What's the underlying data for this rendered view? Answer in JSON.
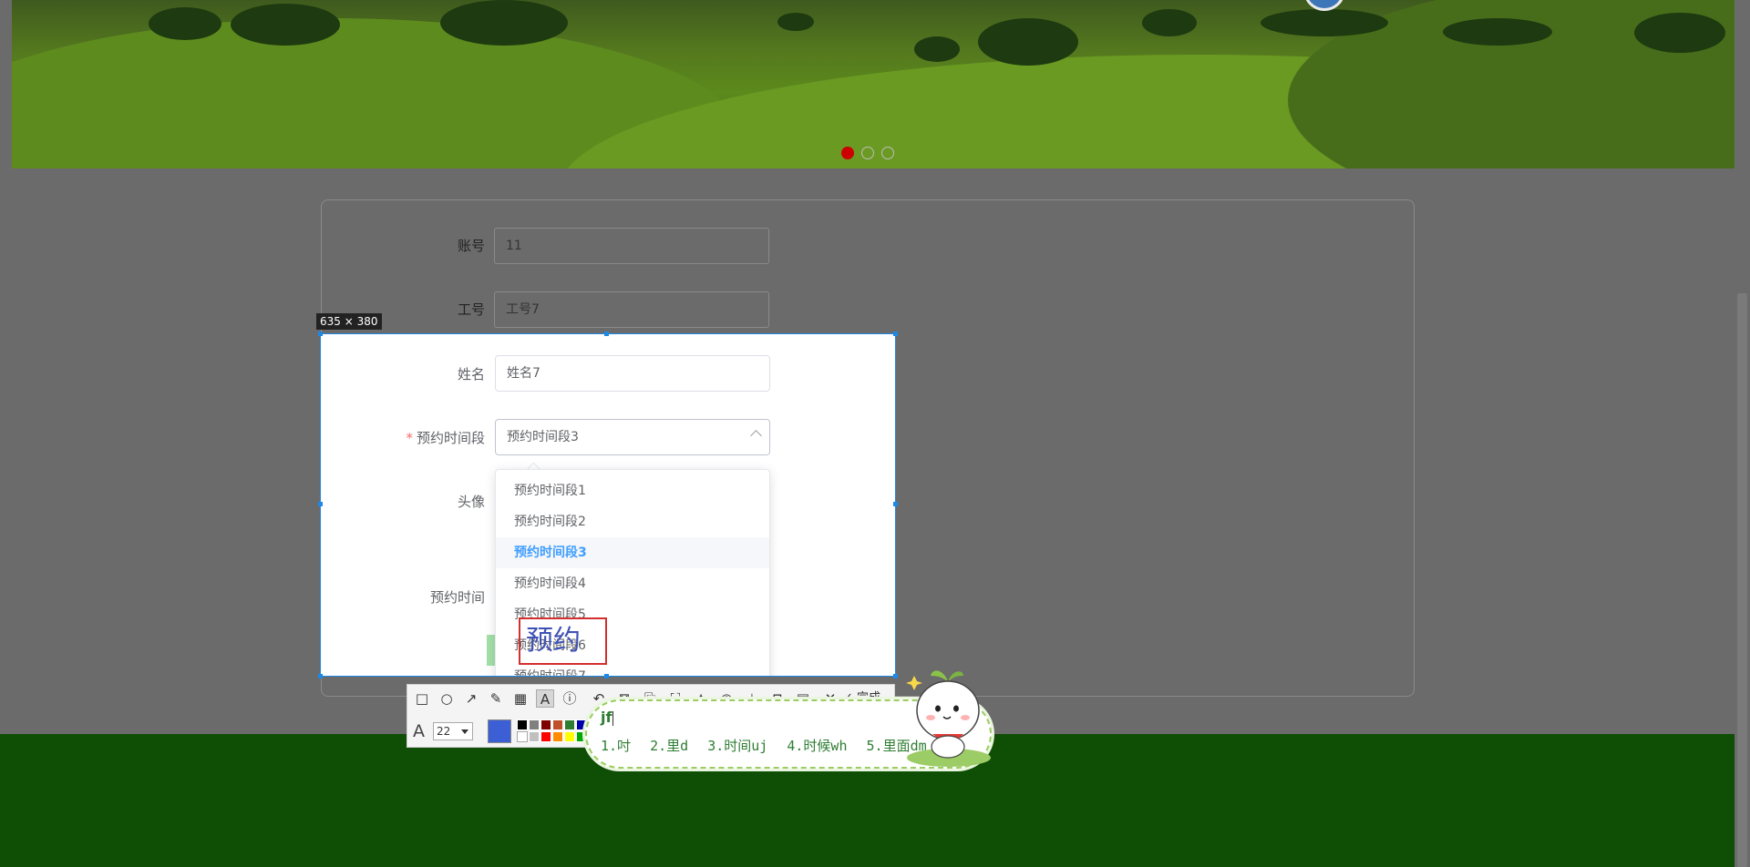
{
  "form": {
    "account_label": "账号",
    "account_value": "11",
    "employee_id_label": "工号",
    "employee_id_value": "工号7",
    "name_label": "姓名",
    "name_value": "姓名7",
    "time_slot_label": "预约时间段",
    "time_slot_required": "*",
    "time_slot_value": "预约时间段3",
    "avatar_label": "头像",
    "appointment_time_label": "预约时间"
  },
  "dropdown": {
    "options": [
      "预约时间段1",
      "预约时间段2",
      "预约时间段3",
      "预约时间段4",
      "预约时间段5",
      "预约时间段6",
      "预约时间段7"
    ],
    "selected_index": 2
  },
  "screenshot_tool": {
    "size_label": "635 × 380",
    "text_annotation": "预约",
    "done_label": "完成",
    "font_size": "22",
    "current_color": "#3d5fd6",
    "swatches_top": [
      "#000000",
      "#808080",
      "#800000",
      "#c0502a",
      "#2e7d32",
      "#0000aa"
    ],
    "swatches_bottom": [
      "#ffffff",
      "#c0c0c0",
      "#ff0000",
      "#ff8c00",
      "#ffff00",
      "#00aa00"
    ],
    "tools": [
      "rectangle-icon",
      "ellipse-icon",
      "arrow-icon",
      "pencil-icon",
      "mosaic-icon",
      "text-icon",
      "number-icon",
      "undo-icon",
      "crop-icon",
      "ocr-icon",
      "translate-icon",
      "pin-icon",
      "record-icon",
      "download-icon",
      "bookmark-icon",
      "copy-icon",
      "close-icon"
    ]
  },
  "ime": {
    "composition": "jf",
    "candidates": [
      "1.吋",
      "2.里d",
      "3.时间uj",
      "4.时候wh",
      "5.里面dm"
    ]
  },
  "colors": {
    "footer": "#0e4e05",
    "selected_option": "#409eff",
    "required_star": "#f56c6c",
    "active_dot": "#cc0000"
  },
  "carousel": {
    "dot_count": 3,
    "active_index": 0
  }
}
